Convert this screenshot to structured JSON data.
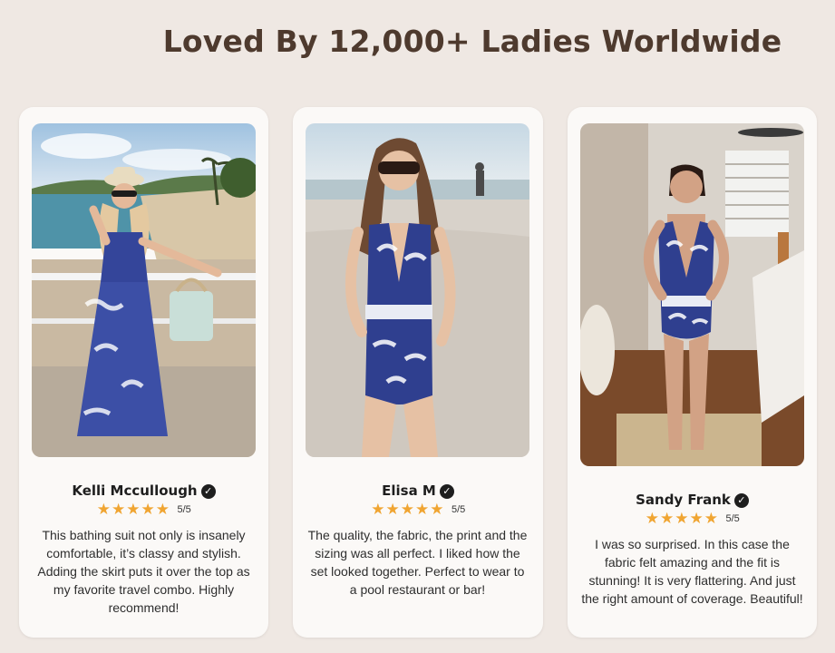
{
  "section": {
    "heading": "Loved By 12,000+ Ladies Worldwide"
  },
  "reviews": [
    {
      "name": "Kelli Mccullough",
      "score_label": "5/5",
      "rating": 5,
      "text": "This bathing suit not only is insanely comfortable, it’s classy and stylish. Adding the skirt puts it over the top as my favorite travel combo. Highly recommend!",
      "photo_icon": "customer-photo"
    },
    {
      "name": "Elisa M",
      "score_label": "5/5",
      "rating": 5,
      "text": "The quality, the fabric, the print and the sizing was all perfect. I liked how the set looked together. Perfect to wear to a pool restaurant or bar!",
      "photo_icon": "customer-photo"
    },
    {
      "name": "Sandy Frank",
      "score_label": "5/5",
      "rating": 5,
      "text": "I was so surprised. In this case the fabric felt amazing and the fit is stunning! It is very flattering. And just the right amount of coverage. Beautiful!",
      "photo_icon": "customer-photo"
    }
  ],
  "colors": {
    "background": "#efe8e3",
    "heading": "#4e3a2e",
    "card": "#fbf9f7",
    "star": "#f0a532",
    "swimsuit_blue": "#2f3f8f"
  },
  "icons": {
    "verified": "verified-check-icon",
    "star": "star-icon"
  }
}
